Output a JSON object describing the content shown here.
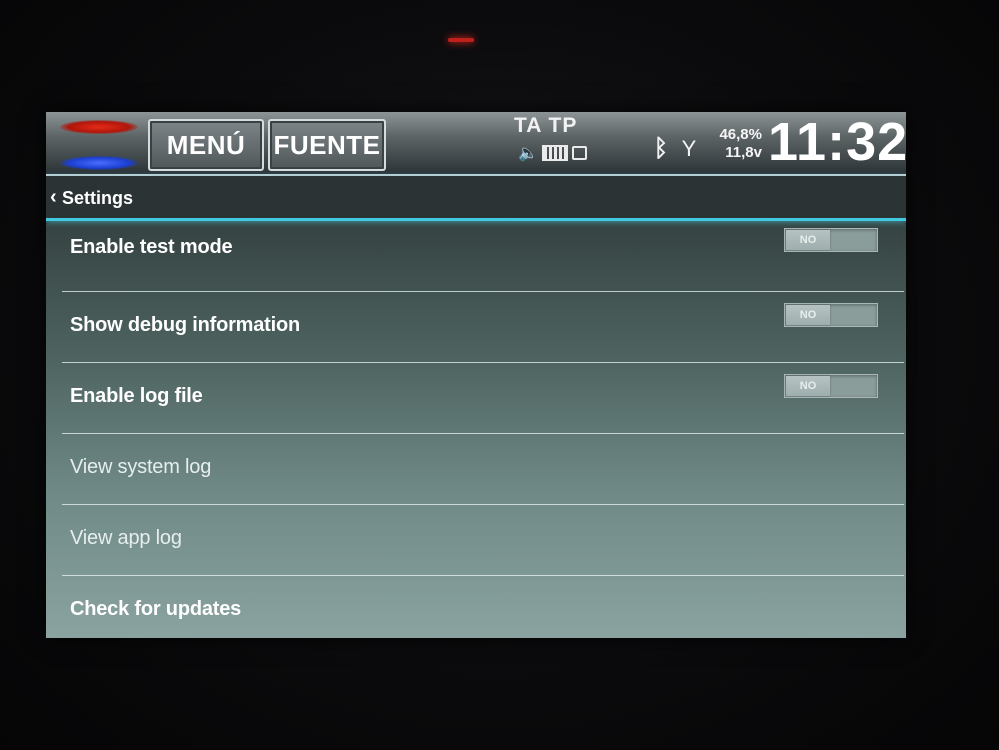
{
  "status_bar": {
    "menu_label": "MENÚ",
    "source_label": "FUENTE",
    "ta_tp": "TA TP",
    "readout_line1": "46,8%",
    "readout_line2": "11,8v",
    "clock": "11:32",
    "icons": [
      "logo-icon",
      "battery-icon",
      "bluetooth-icon",
      "antenna-icon"
    ]
  },
  "header": {
    "title": "Settings",
    "back_icon": "chevron-left-icon",
    "accent_color": "#41c9e0"
  },
  "settings": [
    {
      "label": "Enable test mode",
      "toggle": "NO",
      "enabled": true
    },
    {
      "label": "Show debug information",
      "toggle": "NO",
      "enabled": true
    },
    {
      "label": "Enable log file",
      "toggle": "NO",
      "enabled": true
    },
    {
      "label": "View system log",
      "enabled": false
    },
    {
      "label": "View app log",
      "enabled": false
    },
    {
      "label": "Check for updates",
      "enabled": true
    }
  ]
}
